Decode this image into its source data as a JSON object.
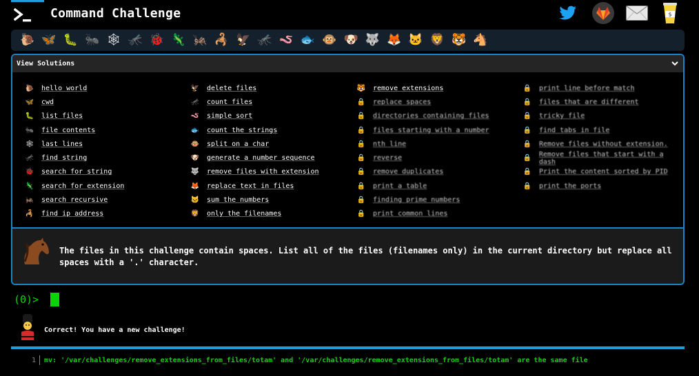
{
  "header": {
    "title": "Command Challenge",
    "icons": [
      "twitter-icon",
      "gitlab-icon",
      "mail-icon",
      "coffee-donate-icon"
    ]
  },
  "progress_strip": {
    "creatures": [
      "🐌",
      "🦋",
      "🐛",
      "🐜",
      "🕸",
      "🦟",
      "🐞",
      "🦎",
      "🦗",
      "🦂",
      "🦅",
      "🦟",
      "🪱",
      "🐟",
      "🐵",
      "🐶",
      "🐺",
      "🦊",
      "🐱",
      "🦁",
      "🐯",
      "🐴"
    ]
  },
  "solutions": {
    "title": "View Solutions",
    "columns": [
      [
        {
          "icon": "🐌",
          "label": "hello world"
        },
        {
          "icon": "🦋",
          "label": "cwd"
        },
        {
          "icon": "🐛",
          "label": "list files"
        },
        {
          "icon": "🐜",
          "label": "file contents"
        },
        {
          "icon": "🕸",
          "label": "last lines"
        },
        {
          "icon": "🦟",
          "label": "find string"
        },
        {
          "icon": "🐞",
          "label": "search for string"
        },
        {
          "icon": "🦎",
          "label": "search for extension"
        },
        {
          "icon": "🦗",
          "label": "search recursive"
        },
        {
          "icon": "🦂",
          "label": "find ip address"
        }
      ],
      [
        {
          "icon": "🦅",
          "label": "delete files"
        },
        {
          "icon": "🦟",
          "label": "count files"
        },
        {
          "icon": "🪱",
          "label": "simple sort"
        },
        {
          "icon": "🐟",
          "label": "count the strings"
        },
        {
          "icon": "🐵",
          "label": "split on a char"
        },
        {
          "icon": "🐶",
          "label": "generate a number sequence"
        },
        {
          "icon": "🐺",
          "label": "remove files with extension"
        },
        {
          "icon": "🦊",
          "label": "replace text in files"
        },
        {
          "icon": "🐱",
          "label": "sum the numbers"
        },
        {
          "icon": "🦁",
          "label": "only the filenames"
        }
      ],
      [
        {
          "icon": "🐯",
          "label": "remove extensions",
          "locked": false
        },
        {
          "icon": "🔒",
          "label": "replace spaces",
          "locked": true
        },
        {
          "icon": "🔒",
          "label": "directories containing files",
          "locked": true
        },
        {
          "icon": "🔒",
          "label": "files starting with a number",
          "locked": true
        },
        {
          "icon": "🔒",
          "label": "nth line",
          "locked": true
        },
        {
          "icon": "🔒",
          "label": "reverse",
          "locked": true
        },
        {
          "icon": "🔒",
          "label": "remove duplicates",
          "locked": true
        },
        {
          "icon": "🔒",
          "label": "print a table",
          "locked": true
        },
        {
          "icon": "🔒",
          "label": "finding prime numbers",
          "locked": true
        },
        {
          "icon": "🔒",
          "label": "print common lines",
          "locked": true
        }
      ],
      [
        {
          "icon": "🔒",
          "label": "print line before match",
          "locked": true
        },
        {
          "icon": "🔒",
          "label": "files that are different",
          "locked": true
        },
        {
          "icon": "🔒",
          "label": "tricky file",
          "locked": true
        },
        {
          "icon": "🔒",
          "label": "find tabs in file",
          "locked": true
        },
        {
          "icon": "🔒",
          "label": "Remove files without extension.",
          "locked": true
        },
        {
          "icon": "🔒",
          "label": "Remove files that start with a dash",
          "locked": true
        },
        {
          "icon": "🔒",
          "label": "Print the content sorted by PID",
          "locked": true
        },
        {
          "icon": "🔒",
          "label": "print the ports",
          "locked": true
        }
      ]
    ]
  },
  "challenge": {
    "icon": "horse-icon",
    "text": "The files in this challenge contain spaces. List all of the files (filenames only) in the current directory but replace all spaces with a '.' character."
  },
  "terminal": {
    "prompt": "(0)>",
    "message": "Correct! You have a new challenge!",
    "output_line_number": "1",
    "output_text": "mv: '/var/challenges/remove_extensions_from_files/totam' and '/var/challenges/remove_extensions_from_files/totam' are the same file"
  },
  "colors": {
    "accent": "#1ea0d6",
    "terminal_green": "#0cd40c",
    "panel_header": "#252525",
    "strip": "#14212c"
  }
}
